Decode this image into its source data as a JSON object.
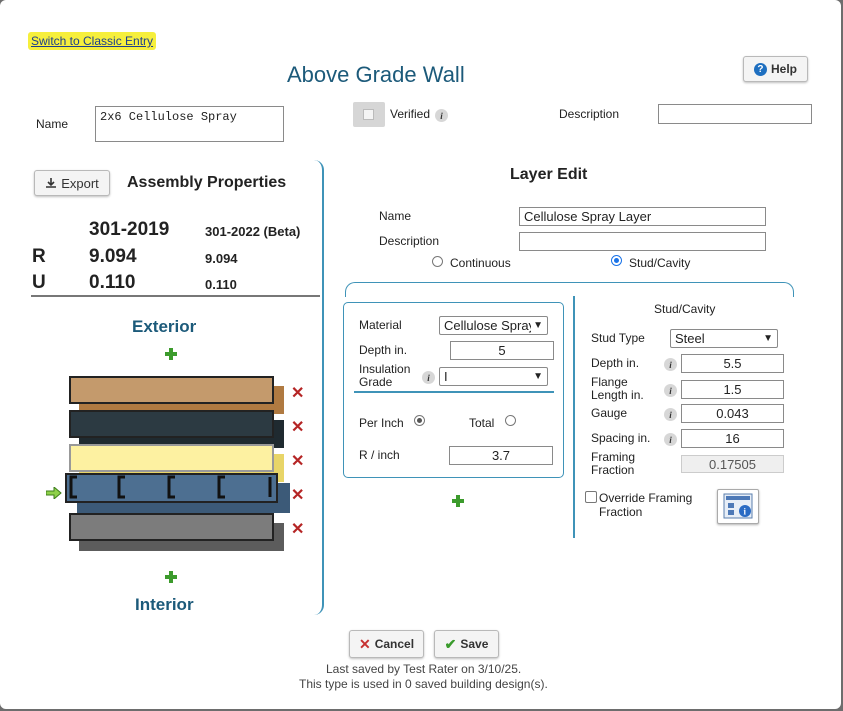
{
  "classic_link": "Switch to Classic Entry",
  "title": "Above Grade Wall",
  "help_label": "Help",
  "name_label": "Name",
  "name_value": "2x6 Cellulose Spray",
  "verified_label": "Verified",
  "description_label": "Description",
  "description_value": "",
  "assembly": {
    "export_label": "Export",
    "heading": "Assembly Properties",
    "col1": "301-2019",
    "col2": "301-2022 (Beta)",
    "r_label": "R",
    "u_label": "U",
    "r_2019": "9.094",
    "r_2022": "9.094",
    "u_2019": "0.110",
    "u_2022": "0.110",
    "exterior": "Exterior",
    "interior": "Interior"
  },
  "layer_edit": {
    "heading": "Layer Edit",
    "name_label": "Name",
    "name_value": "Cellulose Spray Layer",
    "description_label": "Description",
    "description_value": "",
    "continuous_label": "Continuous",
    "stud_cavity_label": "Stud/Cavity",
    "material_label": "Material",
    "material_value": "Cellulose Spray",
    "depth_label": "Depth in.",
    "depth_value": "5",
    "insulation_grade_label": "Insulation Grade",
    "insulation_grade_value": "I",
    "per_inch_label": "Per Inch",
    "total_label": "Total",
    "r_inch_label": "R / inch",
    "r_inch_value": "3.7"
  },
  "stud": {
    "heading": "Stud/Cavity",
    "stud_type_label": "Stud Type",
    "stud_type_value": "Steel",
    "depth_label": "Depth in.",
    "depth_value": "5.5",
    "flange_label": "Flange Length in.",
    "flange_value": "1.5",
    "gauge_label": "Gauge",
    "gauge_value": "0.043",
    "spacing_label": "Spacing in.",
    "spacing_value": "16",
    "framing_label": "Framing Fraction",
    "framing_value": "0.17505",
    "override_label": "Override Framing Fraction"
  },
  "footer": {
    "cancel_label": "Cancel",
    "save_label": "Save",
    "last_saved": "Last saved by Test Rater on 3/10/25.",
    "usage": "This type is used in 0 saved building design(s)."
  },
  "colors": {
    "title": "#1c5a7a",
    "highlight": "#f6ef3c",
    "layer_brown": "#c49a6c",
    "layer_dark": "#2c3a42",
    "layer_yellow": "#fdf1a1",
    "layer_blue": "#4d6f91",
    "layer_gray": "#7c7c7c"
  }
}
